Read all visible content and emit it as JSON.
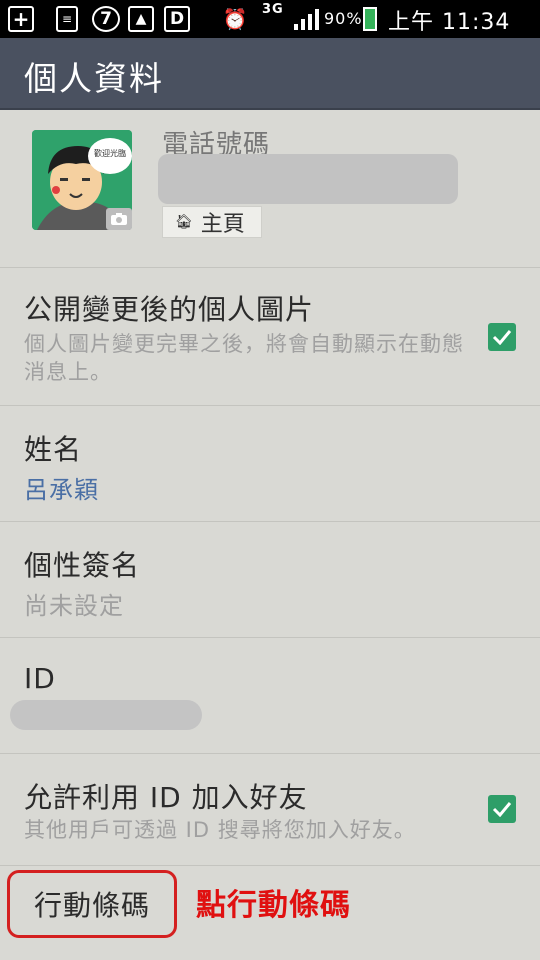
{
  "status_bar": {
    "network": "3G",
    "battery": "90%",
    "time": "上午 11:34",
    "icons": [
      "add-box-icon",
      "notes-icon",
      "seven-icon",
      "image-icon",
      "d-app-icon",
      "alarm-icon",
      "signal-icon",
      "battery-icon"
    ]
  },
  "header": {
    "title": "個人資料"
  },
  "profile": {
    "phone_label": "電話號碼",
    "home_label": "主頁",
    "avatar_bubble": "歡迎光臨"
  },
  "settings": {
    "public_photo": {
      "title": "公開變更後的個人圖片",
      "description": "個人圖片變更完畢之後，將會自動顯示在動態消息上。",
      "checked": true
    },
    "name": {
      "title": "姓名",
      "value": "呂承穎"
    },
    "status_message": {
      "title": "個性簽名",
      "value": "尚未設定"
    },
    "id": {
      "title": "ID"
    },
    "allow_id_search": {
      "title": "允許利用 ID 加入好友",
      "description": "其他用戶可透過 ID 搜尋將您加入好友。",
      "checked": true
    },
    "qr_code": {
      "title": "行動條碼"
    }
  },
  "annotation": "點行動條碼",
  "colors": {
    "title_bar": "#4a5160",
    "checkbox": "#2e9e68",
    "name_value": "#4a6fa5",
    "annotation": "#e01010"
  }
}
